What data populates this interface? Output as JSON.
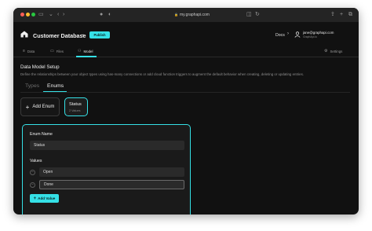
{
  "browser": {
    "url": "my.graphapi.com",
    "lock_icon": "lock-icon",
    "tab_icon": "sidebar-icon",
    "back_icon": "chevron-left-icon",
    "forward_icon": "chevron-right-icon",
    "shield_icon": "shield-icon",
    "refresh_icon": "refresh-icon",
    "share_icon": "share-icon",
    "new_tab_icon": "plus-icon",
    "tabs_icon": "tabs-icon"
  },
  "header": {
    "title": "Customer Database",
    "publish_label": "Publish",
    "docs_label": "Docs",
    "user_email": "jane@graphapi.com",
    "user_sub": "GraphApi.io"
  },
  "subnav": {
    "items": [
      {
        "label": "Data",
        "icon": "database-icon"
      },
      {
        "label": "Files",
        "icon": "folder-icon"
      },
      {
        "label": "Model",
        "icon": "model-icon"
      }
    ],
    "settings_label": "Settings",
    "settings_icon": "gear-icon"
  },
  "main": {
    "title": "Data Model Setup",
    "description": "Define the relationships between your object types using has-many connections or add cloud function triggers to augment the default behavior when creating, deleting or updating entries.",
    "tabs": [
      {
        "label": "Types"
      },
      {
        "label": "Enums"
      }
    ],
    "add_enum_label": "Add Enum",
    "enum_card": {
      "name": "Status",
      "count": "2 Values"
    }
  },
  "enum_editor": {
    "enum_name_label": "Enum Name",
    "enum_name_value": "Status",
    "values_label": "Values",
    "values": [
      "Open",
      "Done"
    ],
    "add_value_label": "Add Value"
  },
  "colors": {
    "accent": "#35e0e6",
    "background": "#111111"
  }
}
